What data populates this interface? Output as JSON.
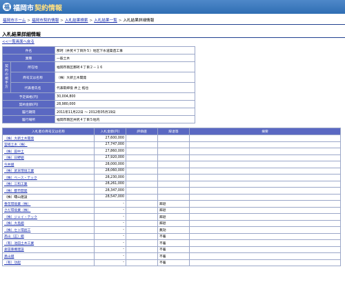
{
  "header": {
    "logo_symbol": "福",
    "title_a": "福岡市",
    "title_b": "契約情報"
  },
  "breadcrumb": [
    "福岡市ホーム",
    "福岡市契約情報",
    "入札結果検索",
    "入札結果一覧",
    "入札結果詳細情報"
  ],
  "page_title": "入札結果詳細情報",
  "back_link": "<<一覧画面へ戻る",
  "info": {
    "group_label": "契約の相手方",
    "rows": [
      {
        "label": "件名",
        "value": "那珂（井尻４丁目外５）地区下水道築造工事"
      },
      {
        "label": "業種",
        "value": "一般土木"
      },
      {
        "label": "所在地",
        "value": "福岡市南区那珂４丁目２－１６"
      },
      {
        "label": "商号又は名称",
        "value": "（株）大新土木開発"
      },
      {
        "label": "代表者氏名",
        "value": "代表取締役 井上 拓也"
      },
      {
        "label": "予定価格(円)",
        "value": "30,004,800"
      },
      {
        "label": "契約金額(円)",
        "value": "28,980,000"
      },
      {
        "label": "履行期間",
        "value": "2011年11月22日 ～ 2012年05月19日"
      },
      {
        "label": "履行場所",
        "value": "福岡市南区井尻４丁目５地内"
      }
    ]
  },
  "bids": {
    "headers": [
      "入札者の商号又は名称",
      "入札金額(円)",
      "評価値",
      "辞退等",
      "摘要"
    ],
    "rows": [
      {
        "name": "（株）大新土木開発",
        "amount": "27,600,000",
        "status": "",
        "link": true
      },
      {
        "name": "宮崎土木（株）",
        "amount": "27,747,000",
        "status": "",
        "link": true
      },
      {
        "name": "（株）田中土",
        "amount": "27,860,000",
        "status": "",
        "link": true
      },
      {
        "name": "（株）日野組",
        "amount": "27,920,000",
        "status": "",
        "link": true
      },
      {
        "name": "今井組",
        "amount": "28,000,000",
        "status": "",
        "link": true
      },
      {
        "name": "（株）武末環境工業",
        "amount": "28,060,000",
        "status": "",
        "link": true
      },
      {
        "name": "（株）ベース・テック",
        "amount": "28,230,000",
        "status": "",
        "link": true
      },
      {
        "name": "（株）三和工業",
        "amount": "28,261,000",
        "status": "",
        "link": true
      },
      {
        "name": "（株）都市開発",
        "amount": "28,347,000",
        "status": "",
        "link": true
      },
      {
        "name": "（株）曙山建設",
        "amount": "28,547,000",
        "status": "",
        "link": false
      },
      {
        "name": "香花環境業（株）",
        "amount": "-",
        "status": "辞退",
        "link": true
      },
      {
        "name": "さだ環境業（株）",
        "amount": "-",
        "status": "辞退",
        "link": true
      },
      {
        "name": "（株）ジェイ・テック",
        "amount": "-",
        "status": "辞退",
        "link": true
      },
      {
        "name": "（株）大島組",
        "amount": "-",
        "status": "辞退",
        "link": true
      },
      {
        "name": "（株）セト環創工",
        "amount": "-",
        "status": "無効",
        "link": true
      },
      {
        "name": "高山（正）組",
        "amount": "-",
        "status": "不着",
        "link": true
      },
      {
        "name": "（有）池田土木工業",
        "amount": "-",
        "status": "不着",
        "link": true
      },
      {
        "name": "倉田重機建設",
        "amount": "-",
        "status": "不着",
        "link": true
      },
      {
        "name": "黒山組",
        "amount": "-",
        "status": "不着",
        "link": true
      },
      {
        "name": "（有）功起",
        "amount": "-",
        "status": "不着",
        "link": true
      }
    ]
  }
}
